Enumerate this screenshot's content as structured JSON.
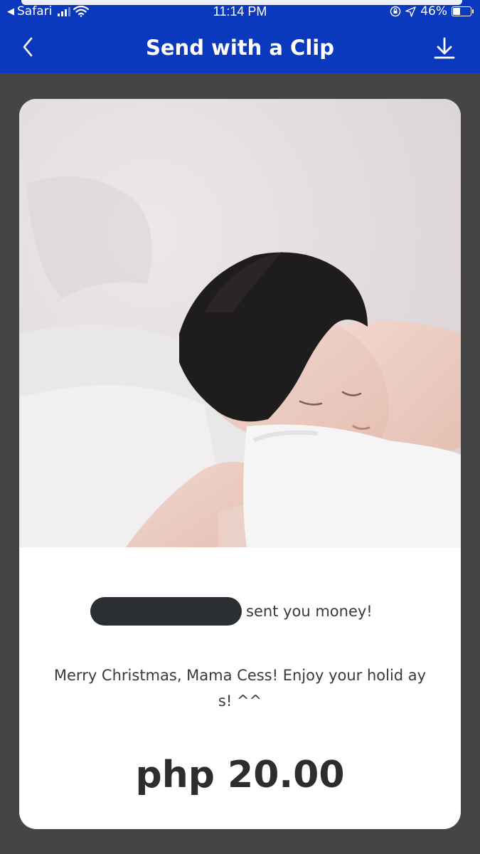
{
  "status_bar": {
    "back_app": "Safari",
    "time": "11:14 PM",
    "battery_percent": "46%",
    "battery_level": 0.46
  },
  "nav": {
    "title": "Send with a Clip",
    "back_icon": "chevron-left-icon",
    "download_icon": "download-icon"
  },
  "card": {
    "sender_suffix": "sent you money!",
    "message": "Merry Christmas, Mama Cess! Enjoy your holid ays! ^^",
    "amount": "php 20.00"
  },
  "colors": {
    "header": "#0b39bd",
    "background": "#454545",
    "card": "#ffffff"
  }
}
